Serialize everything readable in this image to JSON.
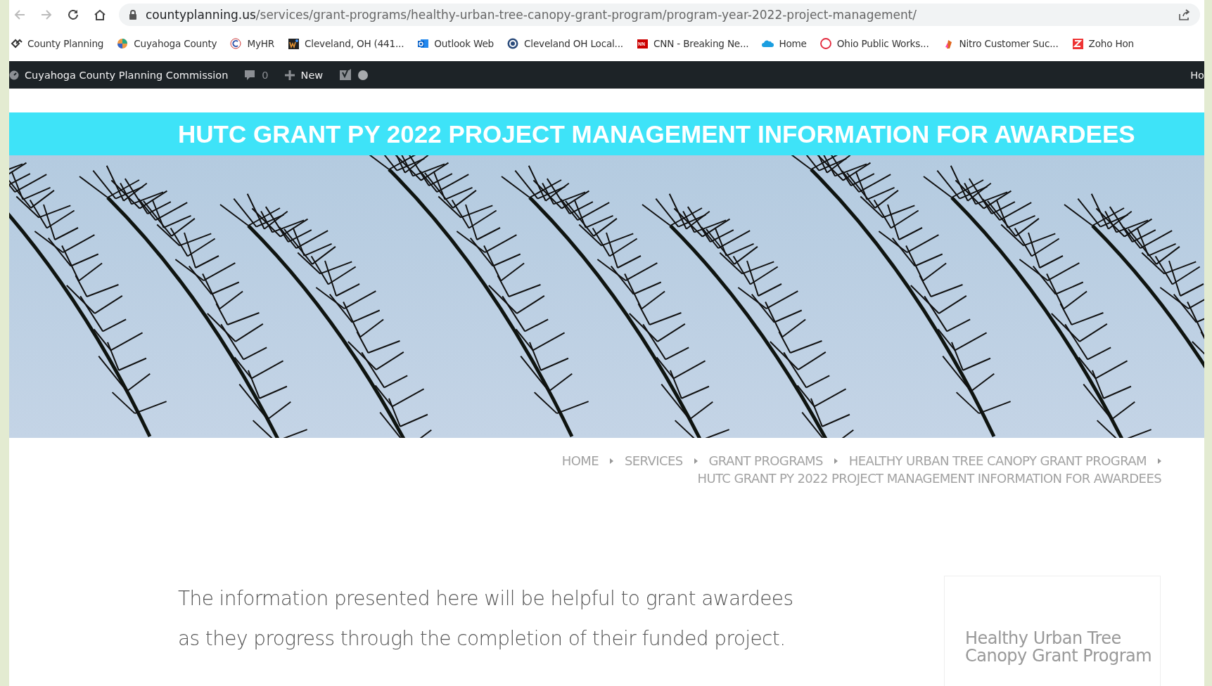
{
  "browser": {
    "url_host": "countyplanning.us",
    "url_path": "/services/grant-programs/healthy-urban-tree-canopy-grant-program/program-year-2022-project-management/"
  },
  "bookmarks": [
    {
      "label": "County Planning"
    },
    {
      "label": "Cuyahoga County"
    },
    {
      "label": "MyHR"
    },
    {
      "label": "Cleveland, OH (441..."
    },
    {
      "label": "Outlook Web"
    },
    {
      "label": "Cleveland OH Local..."
    },
    {
      "label": "CNN - Breaking Ne..."
    },
    {
      "label": "Home"
    },
    {
      "label": "Ohio Public Works..."
    },
    {
      "label": "Nitro Customer Suc..."
    },
    {
      "label": "Zoho Hon"
    }
  ],
  "admin_bar": {
    "site": "Cuyahoga County Planning Commission",
    "comments": "0",
    "new": "New",
    "right_text": "Ho"
  },
  "banner": {
    "title": "HUTC GRANT PY 2022 PROJECT MANAGEMENT INFORMATION FOR AWARDEES"
  },
  "breadcrumb": [
    {
      "label": "HOME"
    },
    {
      "label": "SERVICES"
    },
    {
      "label": "GRANT PROGRAMS"
    },
    {
      "label": "HEALTHY URBAN TREE CANOPY GRANT PROGRAM"
    },
    {
      "label": "HUTC GRANT PY 2022 PROJECT MANAGEMENT INFORMATION FOR AWARDEES"
    }
  ],
  "intro": "The information presented here will be helpful to grant awardees as they progress through the completion of their funded project.",
  "sidebar": {
    "title": "Healthy Urban Tree Canopy Grant Program"
  }
}
